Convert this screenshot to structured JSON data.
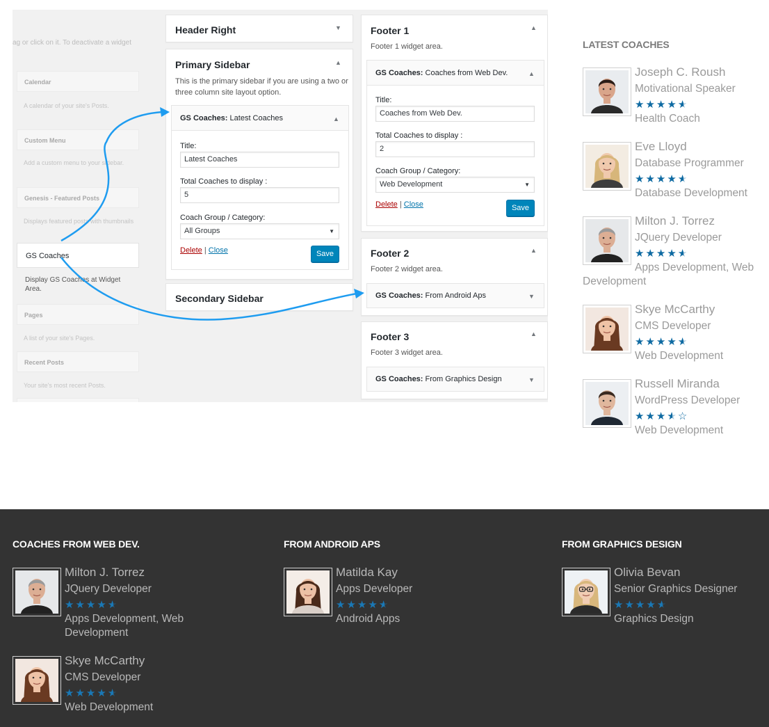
{
  "admin": {
    "available": {
      "hint": "ag or click on it. To deactivate a widget",
      "widgets": [
        {
          "title": "Calendar",
          "desc": "A calendar of your site's Posts."
        },
        {
          "title": "Custom Menu",
          "desc": "Add a custom menu to your sidebar."
        },
        {
          "title": "Genesis - Featured Posts",
          "desc": "Displays featured posts with thumbnails"
        },
        {
          "title": "Pages",
          "desc": "A list of your site's Pages."
        },
        {
          "title": "Recent Posts",
          "desc": "Your site's most recent Posts."
        }
      ],
      "gs_coaches_title": "GS Coaches",
      "gs_coaches_desc": "Display GS Coaches at Widget Area."
    },
    "header_right": {
      "title": "Header Right"
    },
    "primary_sidebar": {
      "title": "Primary Sidebar",
      "desc": "This is the primary sidebar if you are using a two or three column site layout option.",
      "widget": {
        "prefix": "GS Coaches:",
        "name": "Latest Coaches",
        "title_label": "Title:",
        "title_value": "Latest Coaches",
        "total_label": "Total Coaches to display :",
        "total_value": "5",
        "group_label": "Coach Group / Category:",
        "group_value": "All Groups",
        "delete": "Delete",
        "sep": "|",
        "close": "Close",
        "save": "Save"
      }
    },
    "secondary_sidebar": {
      "title": "Secondary Sidebar"
    },
    "footer1": {
      "title": "Footer 1",
      "desc": "Footer 1 widget area.",
      "widget": {
        "prefix": "GS Coaches:",
        "name": "Coaches from Web Dev.",
        "title_label": "Title:",
        "title_value": "Coaches from Web Dev.",
        "total_label": "Total Coaches to display :",
        "total_value": "2",
        "group_label": "Coach Group / Category:",
        "group_value": "Web Development",
        "delete": "Delete",
        "sep": "|",
        "close": "Close",
        "save": "Save"
      }
    },
    "footer2": {
      "title": "Footer 2",
      "desc": "Footer 2 widget area.",
      "widget": {
        "prefix": "GS Coaches:",
        "name": "From Android Aps"
      }
    },
    "footer3": {
      "title": "Footer 3",
      "desc": "Footer 3 widget area.",
      "widget": {
        "prefix": "GS Coaches:",
        "name": "From Graphics Design"
      }
    },
    "arrow_color": "#1e9cf0"
  },
  "latest": {
    "title": "LATEST COACHES",
    "coaches": [
      {
        "name": "Joseph C. Roush",
        "role": "Motivational Speaker",
        "rating": 4.5,
        "category": "Health Coach",
        "photo": "man-dark-hair"
      },
      {
        "name": "Eve Lloyd",
        "role": "Database Programmer",
        "rating": 4.5,
        "category": "Database Development",
        "photo": "woman-blonde"
      },
      {
        "name": "Milton J. Torrez",
        "role": "JQuery Developer",
        "rating": 4.5,
        "category": "Apps Development, Web Development",
        "photo": "man-gray-hair"
      },
      {
        "name": "Skye McCarthy",
        "role": "CMS Developer",
        "rating": 4.5,
        "category": "Web Development",
        "photo": "woman-brunette"
      },
      {
        "name": "Russell Miranda",
        "role": "WordPress Developer",
        "rating": 3.5,
        "category": "Web Development",
        "photo": "man-suit"
      }
    ]
  },
  "footer": {
    "columns": [
      {
        "title": "COACHES FROM WEB DEV.",
        "coaches": [
          {
            "name": "Milton J. Torrez",
            "role": "JQuery Developer",
            "rating": 4.5,
            "category": "Apps Development, Web Development",
            "photo": "man-gray-hair"
          },
          {
            "name": "Skye McCarthy",
            "role": "CMS Developer",
            "rating": 4.5,
            "category": "Web Development",
            "photo": "woman-brunette"
          }
        ]
      },
      {
        "title": "FROM ANDROID APS",
        "coaches": [
          {
            "name": "Matilda Kay",
            "role": "Apps Developer",
            "rating": 4.5,
            "category": "Android Apps",
            "photo": "woman-thinking"
          }
        ]
      },
      {
        "title": "FROM GRAPHICS DESIGN",
        "coaches": [
          {
            "name": "Olivia Bevan",
            "role": "Senior Graphics Designer",
            "rating": 4.5,
            "category": "Graphics Design",
            "photo": "woman-glasses"
          }
        ]
      }
    ]
  },
  "colors": {
    "wp_button": "#0085ba",
    "star_blue": "#0e6aa2",
    "footer_bg": "#333333",
    "link_blue": "#0073aa",
    "delete_red": "#aa0000"
  }
}
